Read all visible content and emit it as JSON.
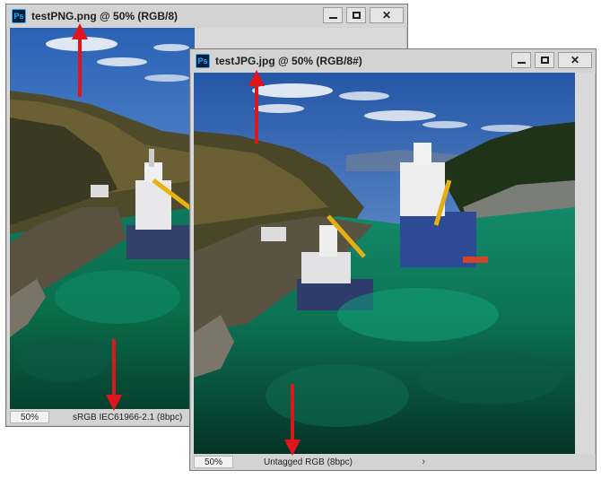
{
  "windows": [
    {
      "icon": "Ps",
      "title": "testPNG.png @ 50% (RGB/8)",
      "zoom": "50%",
      "status": "sRGB IEC61966-2.1 (8bpc)"
    },
    {
      "icon": "Ps",
      "title": "testJPG.jpg @ 50% (RGB/8#)",
      "zoom": "50%",
      "status": "Untagged RGB (8bpc)",
      "status_chevron": "›"
    }
  ],
  "controls": {
    "close_glyph": "✕"
  },
  "colors": {
    "arrow": "#e0151b",
    "chrome": "#d3d3d3",
    "sea": "#0c6b54",
    "sky": "#2f6fbe"
  }
}
